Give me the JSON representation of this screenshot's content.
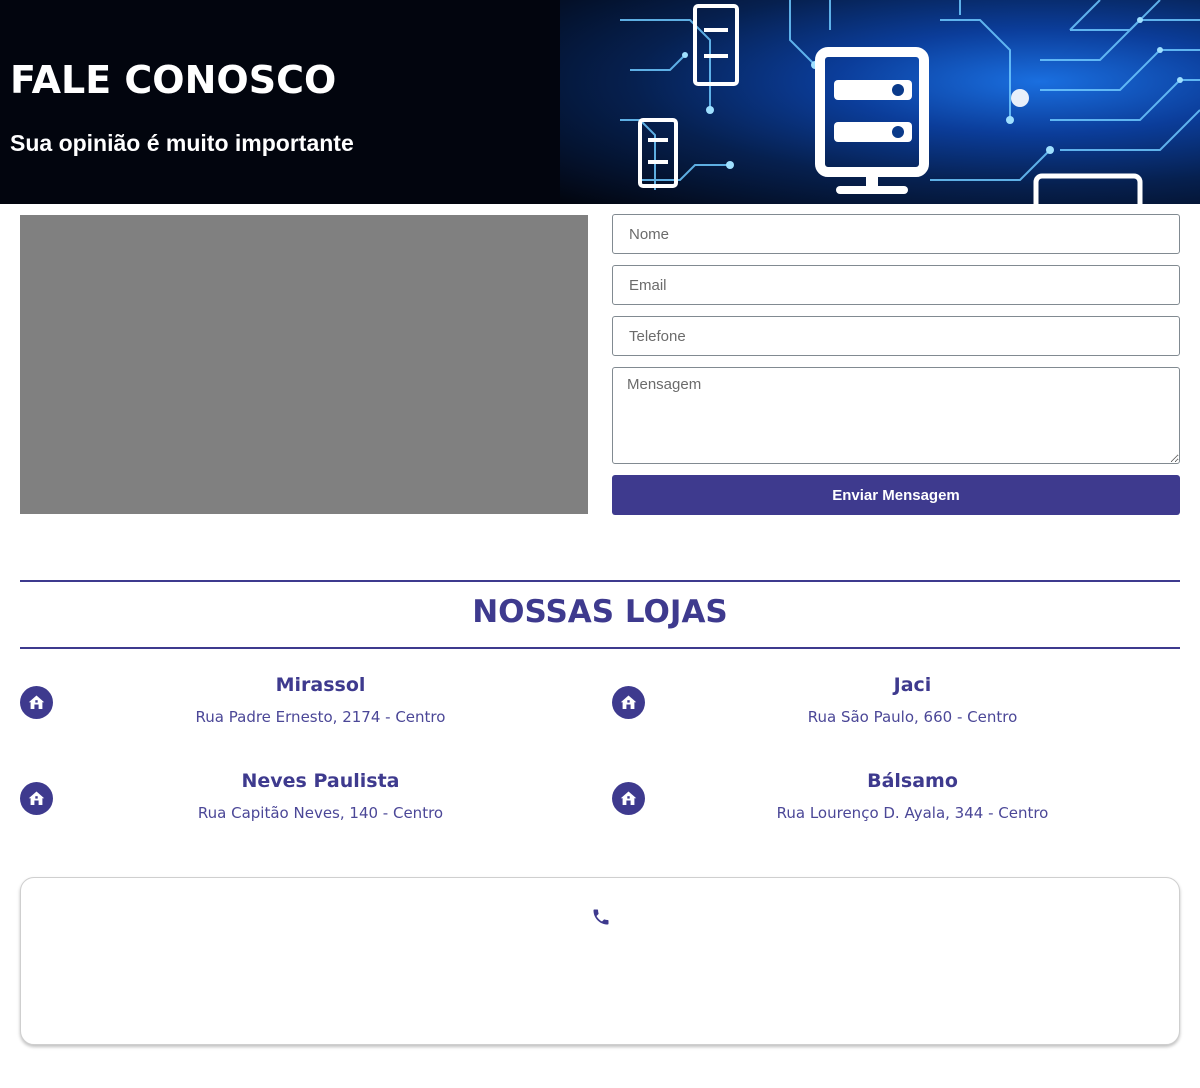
{
  "hero": {
    "title": "FALE CONOSCO",
    "subtitle": "Sua opinião é muito importante"
  },
  "map": {
    "icon": "map-placeholder"
  },
  "form": {
    "name_placeholder": "Nome",
    "email_placeholder": "Email",
    "phone_placeholder": "Telefone",
    "message_placeholder": "Mensagem",
    "submit_label": "Enviar Mensagem"
  },
  "stores": {
    "title": "NOSSAS LOJAS",
    "items": [
      {
        "name": "Mirassol",
        "address": "Rua Padre Ernesto, 2174 - Centro",
        "icon": "home-icon"
      },
      {
        "name": "Jaci",
        "address": "Rua São Paulo, 660 - Centro",
        "icon": "home-icon"
      },
      {
        "name": "Neves Paulista",
        "address": "Rua Capitão Neves, 140 - Centro",
        "icon": "home-icon"
      },
      {
        "name": "Bálsamo",
        "address": "Rua Lourenço D. Ayala, 344 - Centro",
        "icon": "home-icon"
      }
    ]
  },
  "contact": {
    "icon": "phone-icon"
  },
  "colors": {
    "brand": "#3e3a8e",
    "hero_background": "#02050e",
    "map_placeholder": "#808080"
  }
}
